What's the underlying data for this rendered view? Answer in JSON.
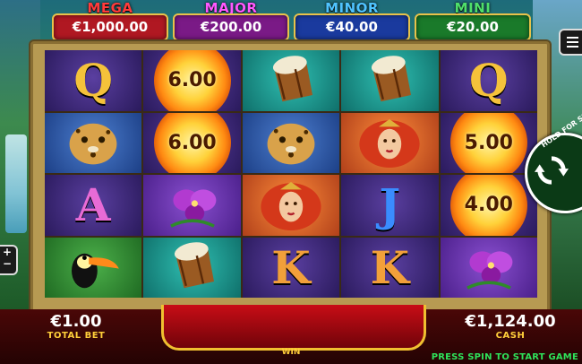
{
  "jackpots": [
    {
      "name": "MEGA",
      "value": "€1,000.00",
      "label_color": "#ff3b3b",
      "box_color": "#b01822"
    },
    {
      "name": "MAJOR",
      "value": "€200.00",
      "label_color": "#ff58ff",
      "box_color": "#7a1a86"
    },
    {
      "name": "MINOR",
      "value": "€40.00",
      "label_color": "#4fc3ff",
      "box_color": "#1a3a9e"
    },
    {
      "name": "MINI",
      "value": "€20.00",
      "label_color": "#4fe06a",
      "box_color": "#1a7a2a"
    }
  ],
  "reels": [
    [
      {
        "symbol": "Q",
        "kind": "letter",
        "bg": "purple",
        "color": "#f5c23a"
      },
      {
        "symbol": "jaguar",
        "kind": "picture",
        "bg": "blue"
      },
      {
        "symbol": "A",
        "kind": "letter",
        "bg": "purple",
        "color": "#e86bd6"
      },
      {
        "symbol": "toucan",
        "kind": "picture",
        "bg": "green"
      }
    ],
    [
      {
        "symbol": "6.00",
        "kind": "fireball",
        "bg": "purple"
      },
      {
        "symbol": "6.00",
        "kind": "fireball",
        "bg": "purple"
      },
      {
        "symbol": "orchid",
        "kind": "picture",
        "bg": "violet"
      },
      {
        "symbol": "drum",
        "kind": "picture",
        "bg": "teal"
      }
    ],
    [
      {
        "symbol": "drum",
        "kind": "picture",
        "bg": "teal"
      },
      {
        "symbol": "jaguar",
        "kind": "picture",
        "bg": "blue"
      },
      {
        "symbol": "goddess",
        "kind": "picture",
        "bg": "orange"
      },
      {
        "symbol": "K",
        "kind": "letter",
        "bg": "purple",
        "color": "#f2a03a"
      }
    ],
    [
      {
        "symbol": "drum",
        "kind": "picture",
        "bg": "teal"
      },
      {
        "symbol": "goddess",
        "kind": "picture",
        "bg": "orange"
      },
      {
        "symbol": "J",
        "kind": "letter",
        "bg": "purple",
        "color": "#3a8cff"
      },
      {
        "symbol": "K",
        "kind": "letter",
        "bg": "purple",
        "color": "#f2a03a"
      }
    ],
    [
      {
        "symbol": "Q",
        "kind": "letter",
        "bg": "purple",
        "color": "#f5c23a"
      },
      {
        "symbol": "5.00",
        "kind": "fireball",
        "bg": "purple"
      },
      {
        "symbol": "4.00",
        "kind": "fireball",
        "bg": "purple"
      },
      {
        "symbol": "orchid",
        "kind": "picture",
        "bg": "violet"
      }
    ]
  ],
  "bottom": {
    "total_bet_value": "€1.00",
    "total_bet_label": "TOTAL BET",
    "win_label": "WIN",
    "cash_value": "€1,124.00",
    "cash_label": "CASH",
    "press_spin": "PRESS SPIN TO START GAME"
  },
  "controls": {
    "hold_for_spin_text": "HOLD FOR SE",
    "zoom_text": "+\n−"
  }
}
